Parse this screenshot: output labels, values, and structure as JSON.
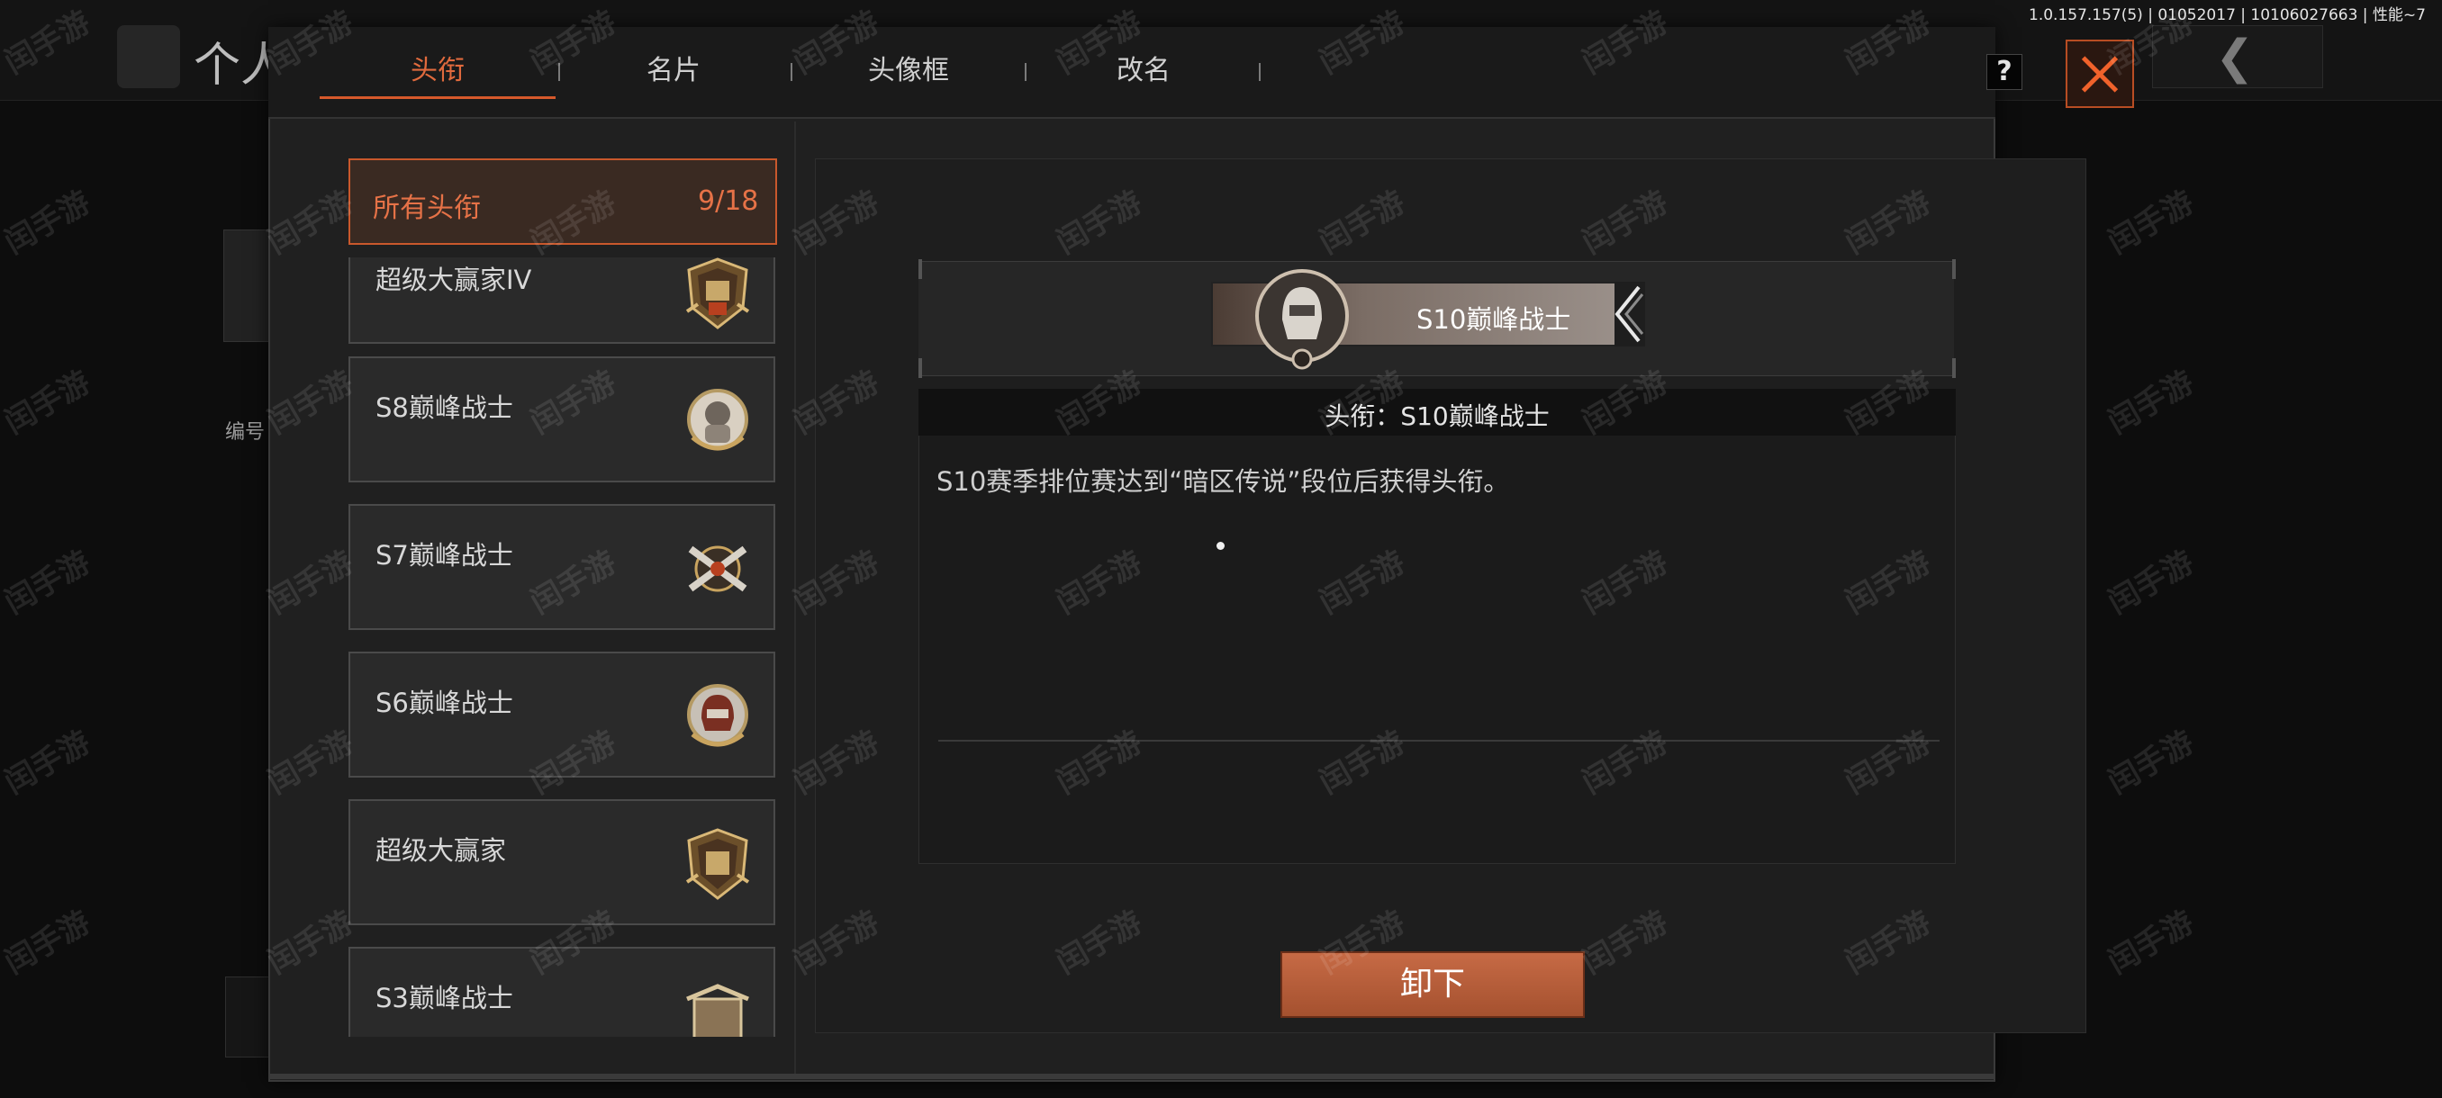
{
  "version_info": "1.0.157.157(5) | 01052017 | 10106027663 | 性能~7",
  "background": {
    "title": "个人",
    "side_text": "编号"
  },
  "tabs": [
    {
      "label": "头衔",
      "active": true
    },
    {
      "label": "名片",
      "active": false
    },
    {
      "label": "头像框",
      "active": false
    },
    {
      "label": "改名",
      "active": false
    }
  ],
  "help_label": "?",
  "title_list": {
    "header_label": "所有头衔",
    "count": "9/18",
    "items": [
      {
        "name": "超级大赢家IV",
        "badge": "winner-badge-icon"
      },
      {
        "name": "S8巅峰战士",
        "badge": "soldier-laurel-badge-icon"
      },
      {
        "name": "S7巅峰战士",
        "badge": "crossed-guns-badge-icon"
      },
      {
        "name": "S6巅峰战士",
        "badge": "helmet-laurel-badge-icon"
      },
      {
        "name": "超级大赢家",
        "badge": "winner-shield-badge-icon"
      },
      {
        "name": "S3巅峰战士",
        "badge": "crate-badge-icon"
      }
    ]
  },
  "detail": {
    "plate_name": "S10巅峰战士",
    "heading": "头衔：S10巅峰战士",
    "description": "S10赛季排位赛达到“暗区传说”段位后获得头衔。"
  },
  "unequip_label": "卸下",
  "watermark": "闰手游",
  "colors": {
    "accent": "#e06a3d",
    "button": "#b85b37",
    "panel": "#202020"
  }
}
